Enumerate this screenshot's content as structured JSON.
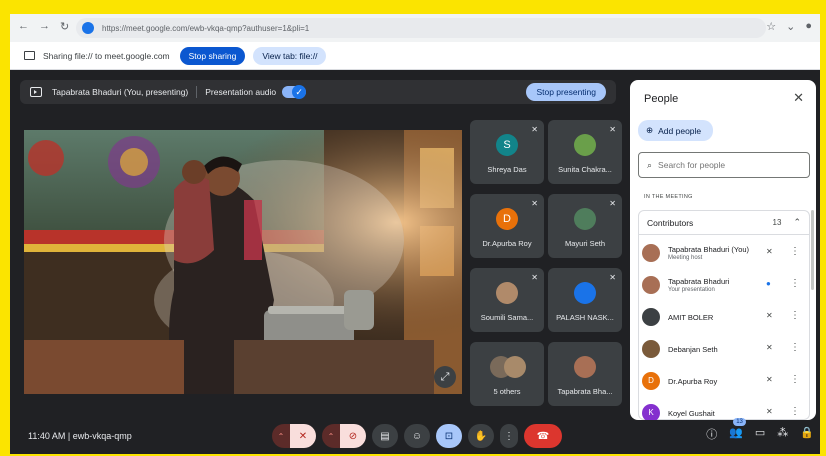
{
  "browser": {
    "url": "https://meet.google.com/ewb-vkqa-qmp?authuser=1&pli=1"
  },
  "share_bar": {
    "text": "Sharing file:// to meet.google.com",
    "stop_label": "Stop sharing",
    "view_label": "View tab: file://"
  },
  "presenting_bar": {
    "presenter": "Tapabrata Bhaduri (You, presenting)",
    "audio_label": "Presentation audio",
    "stop_label": "Stop presenting"
  },
  "tiles": [
    {
      "name": "Shreya Das",
      "initial": "S",
      "color": "#12848a"
    },
    {
      "name": "Sunita Chakra...",
      "initial": "",
      "color": "#6a9f4a"
    },
    {
      "name": "Dr.Apurba Roy",
      "initial": "D",
      "color": "#e8710a"
    },
    {
      "name": "Mayuri Seth",
      "initial": "",
      "color": "#4f7d5c"
    },
    {
      "name": "Soumili Sama...",
      "initial": "",
      "color": "#b08a6a"
    },
    {
      "name": "PALASH NASK...",
      "initial": "",
      "color": "#1a73e8"
    },
    {
      "name": "5 others",
      "initial": "",
      "color": "#7a6a5a"
    },
    {
      "name": "Tapabrata Bha...",
      "initial": "",
      "color": "#a86f55"
    }
  ],
  "people_panel": {
    "title": "People",
    "add_label": "Add people",
    "search_placeholder": "Search for people",
    "section_label": "IN THE MEETING",
    "group_title": "Contributors",
    "group_count": "13",
    "people": [
      {
        "name": "Tapabrata Bhaduri (You)",
        "sub": "Meeting host",
        "initial": "",
        "color": "#a86f55"
      },
      {
        "name": "Tapabrata Bhaduri",
        "sub": "Your presentation",
        "initial": "",
        "color": "#a86f55"
      },
      {
        "name": "AMIT BOLER",
        "sub": "",
        "initial": "",
        "color": "#3c4043"
      },
      {
        "name": "Debanjan Seth",
        "sub": "",
        "initial": "",
        "color": "#7a5a3a"
      },
      {
        "name": "Dr.Apurba Roy",
        "sub": "",
        "initial": "D",
        "color": "#e8710a"
      },
      {
        "name": "Koyel Gushait",
        "sub": "",
        "initial": "K",
        "color": "#8430ce"
      }
    ]
  },
  "bottom_bar": {
    "time": "11:40 AM",
    "meeting_code": "ewb-vkqa-qmp",
    "participant_count": "13"
  }
}
